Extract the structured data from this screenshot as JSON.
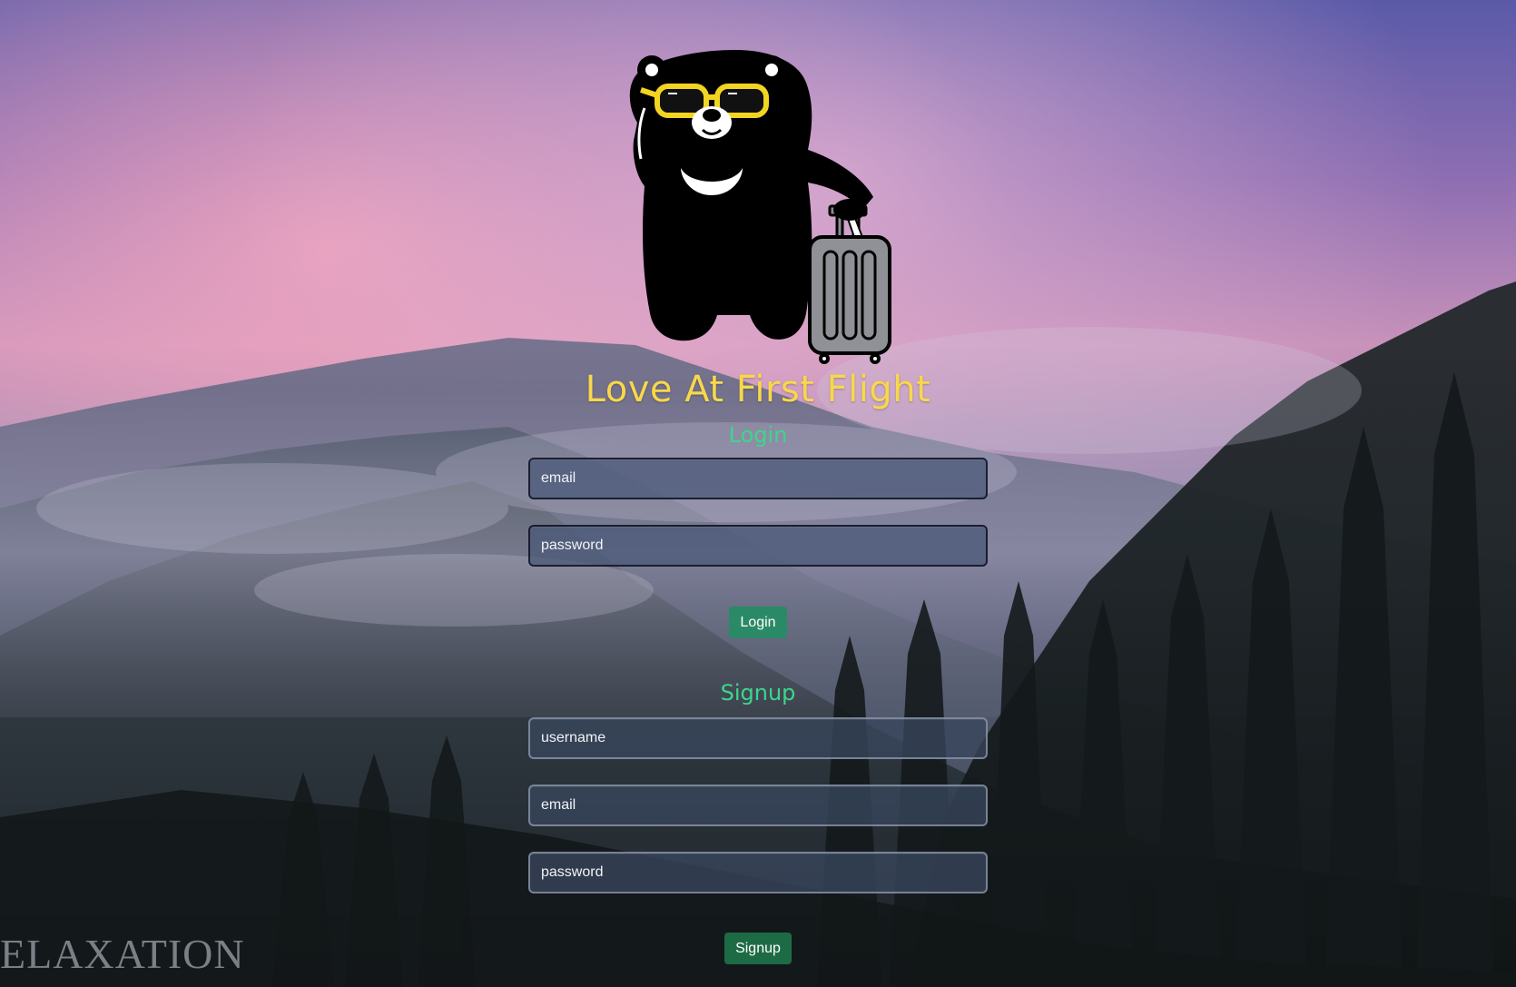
{
  "app": {
    "title": "Love At First Flight",
    "brand_color": "#f7d84a",
    "accent_color": "#3dd68c"
  },
  "logo": {
    "icon": "bear-with-suitcase-icon"
  },
  "login": {
    "heading": "Login",
    "email_placeholder": "email",
    "password_placeholder": "password",
    "button_label": "Login",
    "button_color": "#2a8a67"
  },
  "signup": {
    "heading": "Signup",
    "username_placeholder": "username",
    "email_placeholder": "email",
    "password_placeholder": "password",
    "button_label": "Signup",
    "button_color": "#1d6b45"
  },
  "background": {
    "watermark_text": "ELAXATION"
  }
}
